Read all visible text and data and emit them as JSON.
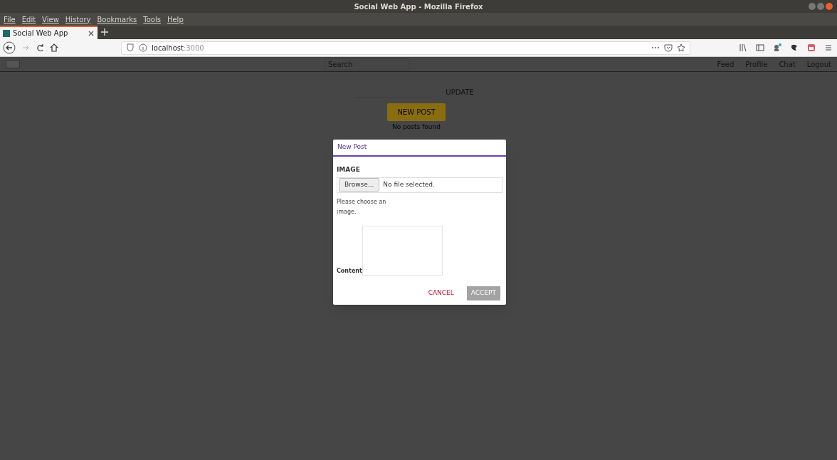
{
  "window": {
    "title": "Social Web App - Mozilla Firefox"
  },
  "menu_bar": [
    "File",
    "Edit",
    "View",
    "History",
    "Bookmarks",
    "Tools",
    "Help"
  ],
  "tabs": [
    {
      "label": "Social Web App",
      "selected": true
    }
  ],
  "address_bar": {
    "host": "localhost",
    "port": ":3000"
  },
  "app_header": {
    "search": {
      "placeholder": "Search"
    },
    "nav": [
      "Feed",
      "Profile",
      "Chat",
      "Logout"
    ]
  },
  "page": {
    "update_button": "UPDATE",
    "new_post_button": "NEW POST",
    "empty_message": "No posts found"
  },
  "dialog": {
    "title": "New Post",
    "image_label": "IMAGE",
    "browse_button": "Browse...",
    "file_status": "No file selected.",
    "error": "Please choose an image.",
    "content_label": "Content",
    "buttons": [
      {
        "kind": "cancel",
        "label": "CANCEL",
        "disabled": false
      },
      {
        "kind": "accept",
        "label": "ACCEPT",
        "disabled": true
      }
    ]
  }
}
